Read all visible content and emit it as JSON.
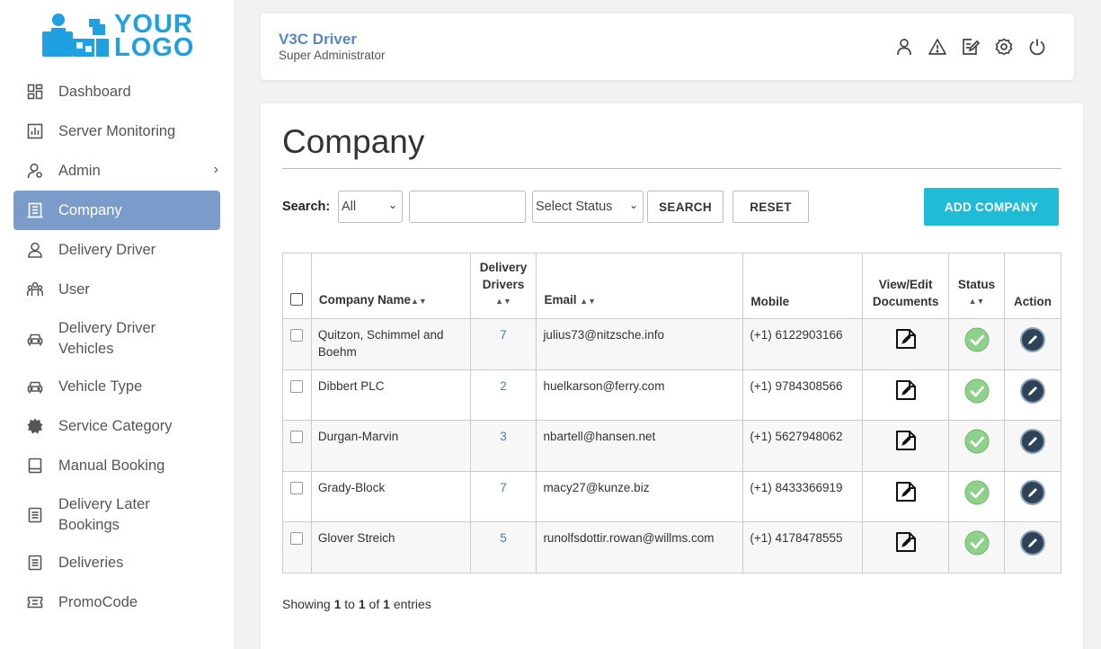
{
  "sidebar": {
    "logo": {
      "line1": "YOUR",
      "line2": "LOGO"
    },
    "items": [
      {
        "label": "Dashboard",
        "icon": "dashboard-icon"
      },
      {
        "label": "Server Monitoring",
        "icon": "chart-icon"
      },
      {
        "label": "Admin",
        "icon": "admin-icon",
        "chevron": "›"
      },
      {
        "label": "Company",
        "icon": "building-icon",
        "active": true
      },
      {
        "label": "Delivery Driver",
        "icon": "driver-icon"
      },
      {
        "label": "User",
        "icon": "users-icon"
      },
      {
        "label": "Delivery Driver Vehicles",
        "icon": "car-icon"
      },
      {
        "label": "Vehicle Type",
        "icon": "car-icon"
      },
      {
        "label": "Service Category",
        "icon": "gear-icon"
      },
      {
        "label": "Manual Booking",
        "icon": "booking-icon"
      },
      {
        "label": "Delivery Later Bookings",
        "icon": "list-icon"
      },
      {
        "label": "Deliveries",
        "icon": "list-icon"
      },
      {
        "label": "PromoCode",
        "icon": "ticket-icon"
      }
    ]
  },
  "header": {
    "title": "V3C Driver",
    "role": "Super Administrator",
    "icons": [
      "user-icon",
      "warning-icon",
      "edit-note-icon",
      "settings-icon",
      "power-icon"
    ]
  },
  "main": {
    "title": "Company",
    "search": {
      "label": "Search:",
      "field_select": "All",
      "text_value": "",
      "status_select": "Select Status",
      "search_button": "SEARCH",
      "reset_button": "RESET",
      "add_button": "ADD COMPANY"
    },
    "table": {
      "columns": {
        "company_name": "Company Name",
        "drivers_line1": "Delivery",
        "drivers_line2": "Drivers",
        "email": "Email",
        "mobile": "Mobile",
        "docs_line1": "View/Edit",
        "docs_line2": "Documents",
        "status": "Status",
        "action": "Action"
      },
      "rows": [
        {
          "name": "Quitzon, Schimmel and Boehm",
          "drivers": "7",
          "email": "julius73@nitzsche.info",
          "mobile": "(+1) 6122903166"
        },
        {
          "name": "Dibbert PLC",
          "drivers": "2",
          "email": "huelkarson@ferry.com",
          "mobile": "(+1) 9784308566"
        },
        {
          "name": "Durgan-Marvin",
          "drivers": "3",
          "email": "nbartell@hansen.net",
          "mobile": "(+1) 5627948062"
        },
        {
          "name": "Grady-Block",
          "drivers": "7",
          "email": "macy27@kunze.biz",
          "mobile": "(+1) 8433366919"
        },
        {
          "name": "Glover Streich",
          "drivers": "5",
          "email": "runolfsdottir.rowan@willms.com",
          "mobile": "(+1) 4178478555"
        }
      ]
    },
    "footer": {
      "prefix": "Showing",
      "from": "1",
      "to_word": "to",
      "to": "1",
      "of_word": "of",
      "total": "1",
      "suffix": "entries"
    }
  },
  "colors": {
    "accent": "#7b9ccb",
    "add_button": "#1fbcd7",
    "status_ok": "#8ed18a",
    "action_dark": "#2f4358",
    "logo": "#1fa0e0"
  }
}
